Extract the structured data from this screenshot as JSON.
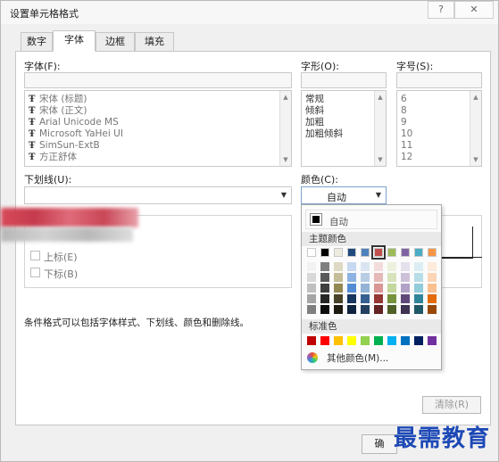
{
  "dialog": {
    "title": "设置单元格格式",
    "help": "?",
    "close": "✕"
  },
  "tabs": [
    "数字",
    "字体",
    "边框",
    "填充"
  ],
  "font": {
    "label": "字体(F):",
    "items": [
      "宋体 (标题)",
      "宋体 (正文)",
      "Arial Unicode MS",
      "Microsoft YaHei UI",
      "SimSun-ExtB",
      "方正舒体"
    ]
  },
  "style": {
    "label": "字形(O):",
    "items": [
      "常规",
      "倾斜",
      "加粗",
      "加粗倾斜"
    ]
  },
  "size": {
    "label": "字号(S):",
    "items": [
      "6",
      "8",
      "9",
      "10",
      "11",
      "12"
    ]
  },
  "underline": {
    "label": "下划线(U):"
  },
  "color": {
    "label": "颜色(C):",
    "value": "自动"
  },
  "effects": {
    "superscript": "上标(E)",
    "subscript": "下标(B)"
  },
  "info_text": "条件格式可以包括字体样式、下划线、颜色和删除线。",
  "color_popup": {
    "auto_label": "自动",
    "theme_header": "主题颜色",
    "standard_header": "标准色",
    "more_colors": "其他颜色(M)...",
    "theme_colors": [
      [
        "#ffffff",
        "#000000",
        "#eeece1",
        "#1f497d",
        "#4f81bd",
        "#c0504d",
        "#9bbb59",
        "#8064a2",
        "#4bacc6",
        "#f79646"
      ],
      [
        "#f2f2f2",
        "#7f7f7f",
        "#ddd9c3",
        "#c6d9f0",
        "#dbe5f1",
        "#f2dcdb",
        "#ebf1dd",
        "#e5e0ec",
        "#dbeef3",
        "#fdeada"
      ],
      [
        "#d8d8d8",
        "#595959",
        "#c4bd97",
        "#8db3e2",
        "#b8cce4",
        "#e5b9b7",
        "#d7e3bc",
        "#ccc1d9",
        "#b7dde8",
        "#fbd5b5"
      ],
      [
        "#bfbfbf",
        "#3f3f3f",
        "#938953",
        "#548dd4",
        "#95b3d7",
        "#d99694",
        "#c3d69b",
        "#b2a2c7",
        "#92cddc",
        "#fac08f"
      ],
      [
        "#a5a5a5",
        "#262626",
        "#494429",
        "#17365d",
        "#366092",
        "#953734",
        "#76923c",
        "#5f497a",
        "#31859b",
        "#e36c09"
      ],
      [
        "#7f7f7f",
        "#0c0c0c",
        "#1d1b10",
        "#0f243e",
        "#244061",
        "#632423",
        "#4f6128",
        "#3f3151",
        "#205867",
        "#974806"
      ]
    ],
    "standard_colors": [
      "#c00000",
      "#ff0000",
      "#ffc000",
      "#ffff00",
      "#92d050",
      "#00b050",
      "#00b0f0",
      "#0070c0",
      "#002060",
      "#7030a0"
    ]
  },
  "buttons": {
    "clear": "清除(R)",
    "ok": "确"
  },
  "watermark": "最需教育"
}
